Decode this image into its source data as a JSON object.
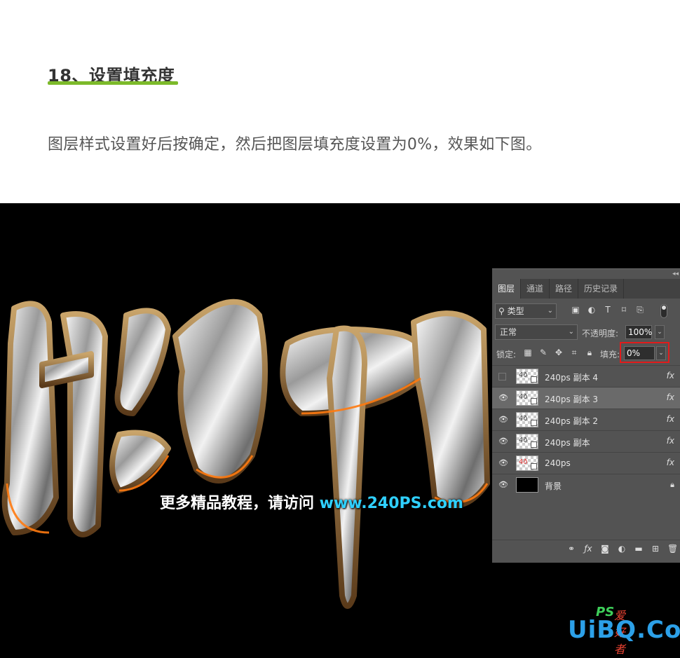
{
  "article": {
    "step_title": "18、设置填充度",
    "description": "图层样式设置好后按确定，然后把图层填充度设置为0%，效果如下图。"
  },
  "canvas": {
    "watermark_prefix": "更多精品教程，请访问 ",
    "watermark_url": "www.240PS.com"
  },
  "layers_panel": {
    "collapse_icon": "double-chevron-left-icon",
    "tabs": [
      "图层",
      "通道",
      "路径",
      "历史记录"
    ],
    "active_tab": "图层",
    "filter": {
      "label": "类型",
      "icon": "search-icon"
    },
    "blend_mode": "正常",
    "opacity_label": "不透明度:",
    "opacity_value": "100%",
    "lock_label": "锁定:",
    "fill_label": "填充:",
    "fill_value": "0%",
    "layers": [
      {
        "name": "240ps 副本 4",
        "visible": false,
        "fx": "fx",
        "selected": false
      },
      {
        "name": "240ps 副本 3",
        "visible": true,
        "fx": "fx",
        "selected": true
      },
      {
        "name": "240ps 副本 2",
        "visible": true,
        "fx": "fx",
        "selected": false
      },
      {
        "name": "240ps  副本",
        "visible": true,
        "fx": "fx",
        "selected": false
      },
      {
        "name": "240ps",
        "visible": true,
        "fx": "fx",
        "selected": false
      },
      {
        "name": "背景",
        "visible": true,
        "fx": "",
        "locked": true,
        "selected": false
      }
    ],
    "highlight_color": "#e21b1b"
  },
  "site_logo": {
    "ps": "PS",
    "cn": "爱好者",
    "main": "UiBQ.CoM"
  },
  "colors": {
    "accent_underline": "#7cba2a",
    "url": "#2fd0ff",
    "logo_blue": "#2ca0e8"
  }
}
